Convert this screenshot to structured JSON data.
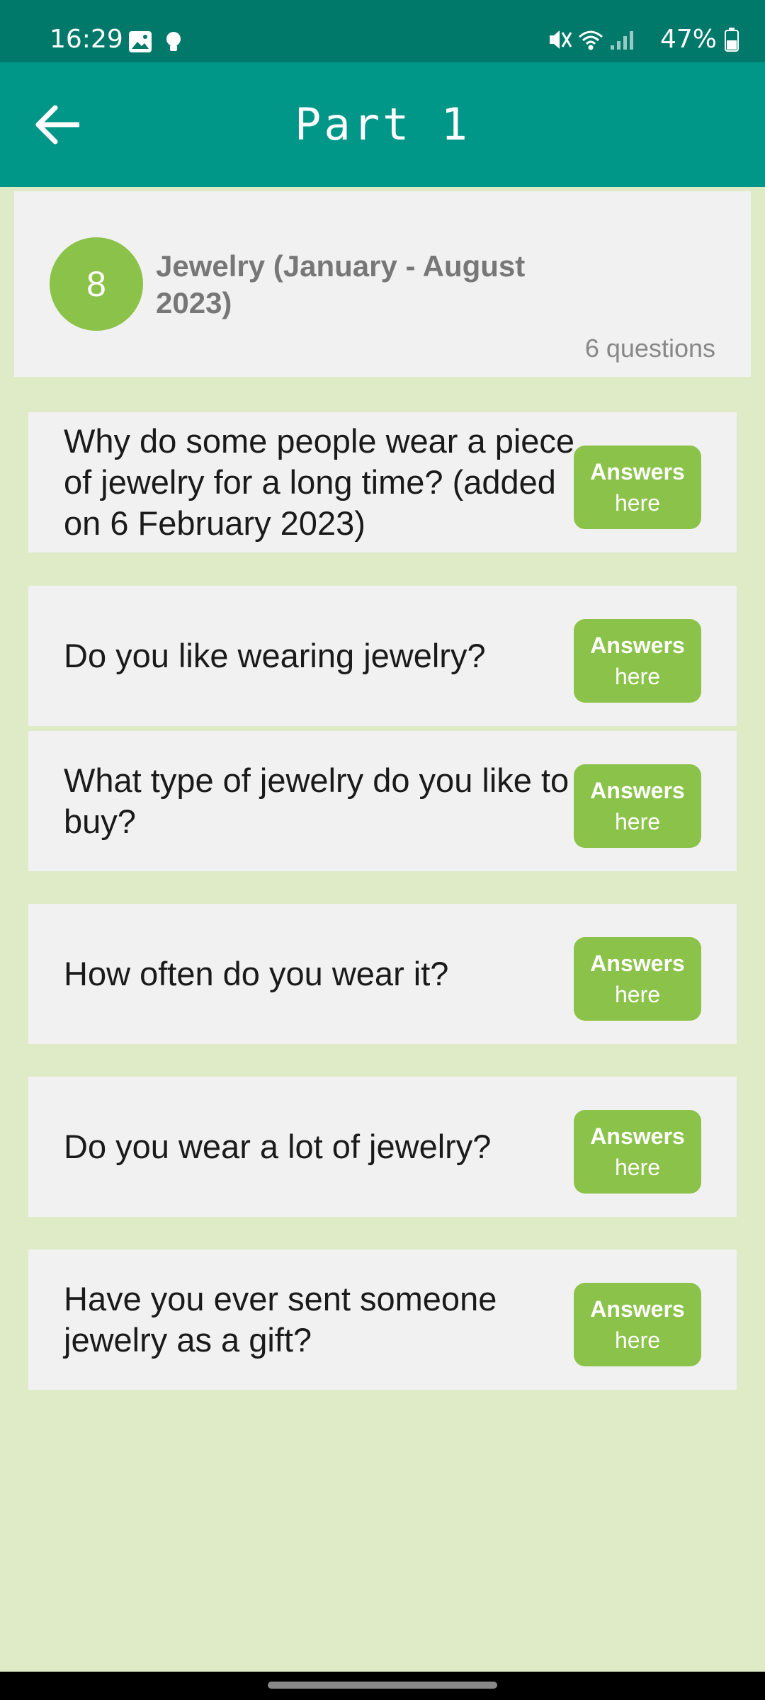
{
  "status": {
    "time": "16:29",
    "battery": "47%",
    "icons_left": [
      "image-icon",
      "lightbulb-icon"
    ],
    "icons_right": [
      "mute-icon",
      "wifi-icon",
      "signal-icon",
      "battery-icon"
    ]
  },
  "appbar": {
    "title": "Part 1",
    "back_icon": "arrow-left-icon"
  },
  "topic": {
    "number": "8",
    "title": "Jewelry (January - August 2023)",
    "count": "6 questions"
  },
  "questions": [
    {
      "text": "Why do some people wear a piece of jewelry for a long time? (added on 6 February 2023)",
      "btn_line1": "Answers",
      "btn_line2": "here"
    },
    {
      "text": "Do you like wearing jewelry?",
      "btn_line1": "Answers",
      "btn_line2": "here"
    },
    {
      "text": "What type of jewelry do you like to buy?",
      "btn_line1": "Answers",
      "btn_line2": "here"
    },
    {
      "text": "How often do you wear it?",
      "btn_line1": "Answers",
      "btn_line2": "here"
    },
    {
      "text": "Do you wear a lot of jewelry?",
      "btn_line1": "Answers",
      "btn_line2": "here"
    },
    {
      "text": "Have you ever sent someone jewelry as a gift?",
      "btn_line1": "Answers",
      "btn_line2": "here"
    }
  ],
  "colors": {
    "statusbar": "#00796B",
    "appbar": "#009688",
    "accent_green": "#8BC34A",
    "background": "#DEEBC6",
    "card": "#F1F1F1"
  }
}
